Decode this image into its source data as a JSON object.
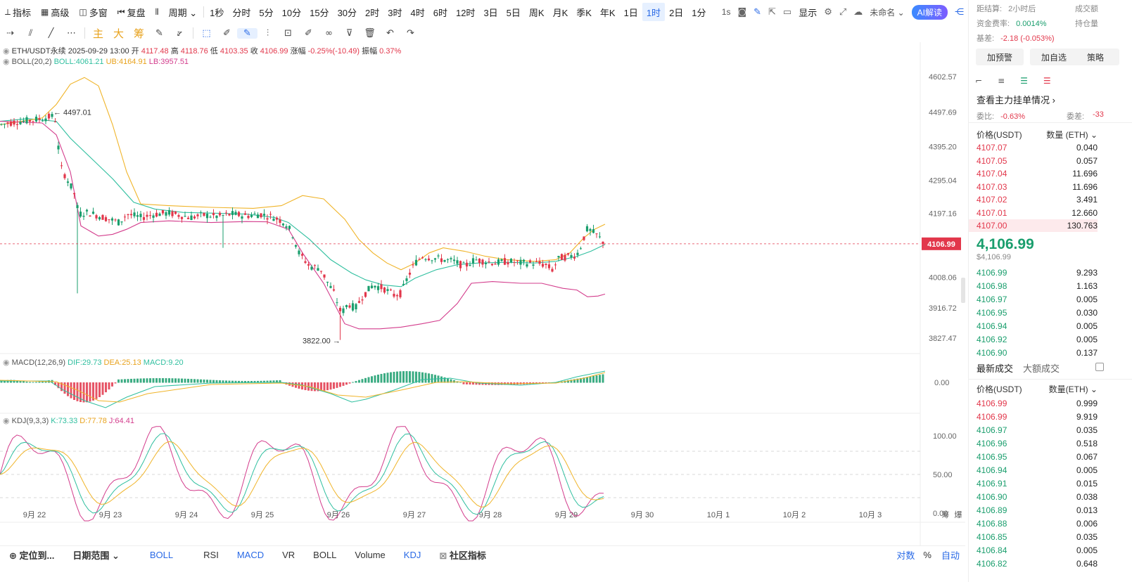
{
  "topbar": {
    "left_items": [
      {
        "icon": "indicator-icon",
        "glyph": "⟂",
        "label": "指标"
      },
      {
        "icon": "calendar-icon",
        "glyph": "▦",
        "label": "高级"
      },
      {
        "icon": "multiwindow-icon",
        "glyph": "◫",
        "label": "多窗"
      },
      {
        "icon": "replay-icon",
        "glyph": "⏮",
        "label": "复盘"
      },
      {
        "icon": "candle-icon",
        "glyph": "⫴",
        "label": ""
      },
      {
        "icon": "",
        "glyph": "",
        "label": "周期 ⌄"
      }
    ],
    "periods": [
      "1秒",
      "分时",
      "5分",
      "10分",
      "15分",
      "30分",
      "2时",
      "3时",
      "4时",
      "6时",
      "12时",
      "3日",
      "5日",
      "周K",
      "月K",
      "季K",
      "年K",
      "1日",
      "1时",
      "2日",
      "1分"
    ],
    "active_period": "1时",
    "right": {
      "seconds": "1s",
      "display": "显示",
      "unnamed": "未命名 ⌄",
      "ai": "AI解读"
    }
  },
  "drawbar": {
    "tools": [
      {
        "name": "h-line-icon",
        "glyph": "⇢"
      },
      {
        "name": "ray-icon",
        "glyph": "⫽"
      },
      {
        "name": "line-icon",
        "glyph": "╱"
      },
      {
        "name": "more-icon",
        "glyph": "⋯"
      },
      {
        "name": "main-label",
        "glyph": "主",
        "type": "orange"
      },
      {
        "name": "big-label",
        "glyph": "大",
        "type": "orange"
      },
      {
        "name": "chip-label",
        "glyph": "筹",
        "type": "orange"
      },
      {
        "name": "edit-icon",
        "glyph": "✎"
      },
      {
        "name": "ruler-icon",
        "glyph": "⦫"
      },
      {
        "name": "select-icon",
        "glyph": "⬚",
        "type": "blue"
      },
      {
        "name": "pen-icon",
        "glyph": "✐"
      },
      {
        "name": "brush-icon",
        "glyph": "✎",
        "type": "sel"
      },
      {
        "name": "candles-icon",
        "glyph": "⫶"
      },
      {
        "name": "box-icon",
        "glyph": "⊡"
      },
      {
        "name": "note-icon",
        "glyph": "✐"
      },
      {
        "name": "link-icon",
        "glyph": "∞"
      },
      {
        "name": "filter-icon",
        "glyph": "⊽"
      },
      {
        "name": "trash-icon",
        "glyph": "🗑"
      },
      {
        "name": "undo-icon",
        "glyph": "↶"
      },
      {
        "name": "redo-icon",
        "glyph": "↷"
      }
    ]
  },
  "chart": {
    "symbol_line": {
      "symbol": "ETH/USDT永续",
      "datetime": "2025-09-29 13:00",
      "open_label": "开",
      "open": "4117.48",
      "high_label": "高",
      "high": "4118.76",
      "low_label": "低",
      "low": "4103.35",
      "close_label": "收",
      "close": "4106.99",
      "change_label": "涨幅",
      "change": "-0.25%(-10.49)",
      "amp_label": "振幅",
      "amp": "0.37%"
    },
    "boll_line": {
      "name": "BOLL(20,2)",
      "boll": "BOLL:4061.21",
      "ub": "UB:4164.91",
      "lb": "LB:3957.51"
    },
    "macd_line": {
      "name": "MACD(12,26,9)",
      "dif": "DIF:29.73",
      "dea": "DEA:25.13",
      "macd": "MACD:9.20"
    },
    "kdj_line": {
      "name": "KDJ(9,3,3)",
      "k": "K:73.33",
      "d": "D:77.78",
      "j": "J:64.41"
    },
    "price_ticks": [
      "4602.57",
      "4497.69",
      "4395.20",
      "4295.04",
      "4197.16",
      "4008.06",
      "3916.72",
      "3827.47"
    ],
    "price_tag": "4106.99",
    "high_marker": "4497.01",
    "low_marker": "3822.00",
    "macd_tick": "0.00",
    "kdj_ticks": [
      "100.00",
      "50.00",
      "0.00"
    ],
    "date_ticks": [
      "9月 22",
      "9月 23",
      "9月 24",
      "9月 25",
      "9月 26",
      "9月 27",
      "9月 28",
      "9月 29",
      "9月 30",
      "10月 1",
      "10月 2",
      "10月 3"
    ],
    "corner_labels": [
      "筹",
      "爆"
    ],
    "colors": {
      "up": "#1a9e6d",
      "down": "#e2374b",
      "mid": "#2fbf9f",
      "ub": "#f0b429",
      "lb": "#d33c8c"
    }
  },
  "bottombar": {
    "locate": "定位到...",
    "range": "日期范围 ⌄",
    "boll_active": "BOLL",
    "indicators": [
      "RSI",
      "MACD",
      "VR",
      "BOLL",
      "Volume",
      "KDJ"
    ],
    "community": "社区指标",
    "right": [
      "对数",
      "%",
      "自动"
    ]
  },
  "rightpanel": {
    "settle_label": "距结算:",
    "settle_value": "2小时后",
    "funding_label": "资金费率:",
    "funding_value": "0.0014%",
    "basis_label": "基差:",
    "basis_value": "-2.18 (-0.053%)",
    "volume_label": "成交额",
    "position_label": "持仓量",
    "buttons": [
      "加预警",
      "加自选",
      "策略"
    ],
    "main_orders": "查看主力挂单情况 ›",
    "ratio_label": "委比:",
    "ratio_value": "-0.63%",
    "diff_label": "委差:",
    "diff_value": "-33",
    "ob_head": [
      "价格(USDT)",
      "数量 (ETH) ⌄"
    ],
    "asks": [
      [
        "4107.07",
        "0.040"
      ],
      [
        "4107.05",
        "0.057"
      ],
      [
        "4107.04",
        "11.696"
      ],
      [
        "4107.03",
        "11.696"
      ],
      [
        "4107.02",
        "3.491"
      ],
      [
        "4107.01",
        "12.660"
      ],
      [
        "4107.00",
        "130.763"
      ]
    ],
    "last_price": "4,106.99",
    "last_usd": "$4,106.99",
    "bids": [
      [
        "4106.99",
        "9.293"
      ],
      [
        "4106.98",
        "1.163"
      ],
      [
        "4106.97",
        "0.005"
      ],
      [
        "4106.95",
        "0.030"
      ],
      [
        "4106.94",
        "0.005"
      ],
      [
        "4106.92",
        "0.005"
      ],
      [
        "4106.90",
        "0.137"
      ]
    ],
    "trade_tabs": [
      "最新成交",
      "大额成交"
    ],
    "trades_head": [
      "价格(USDT)",
      "数量(ETH) ⌄"
    ],
    "trades": [
      [
        "4106.99",
        "0.999",
        "red"
      ],
      [
        "4106.99",
        "9.919",
        "red"
      ],
      [
        "4106.97",
        "0.035",
        "green"
      ],
      [
        "4106.96",
        "0.518",
        "green"
      ],
      [
        "4106.95",
        "0.067",
        "green"
      ],
      [
        "4106.94",
        "0.005",
        "green"
      ],
      [
        "4106.91",
        "0.015",
        "green"
      ],
      [
        "4106.90",
        "0.038",
        "green"
      ],
      [
        "4106.89",
        "0.013",
        "green"
      ],
      [
        "4106.88",
        "0.006",
        "green"
      ],
      [
        "4106.85",
        "0.035",
        "green"
      ],
      [
        "4106.84",
        "0.005",
        "green"
      ],
      [
        "4106.82",
        "0.648",
        "green"
      ]
    ]
  }
}
